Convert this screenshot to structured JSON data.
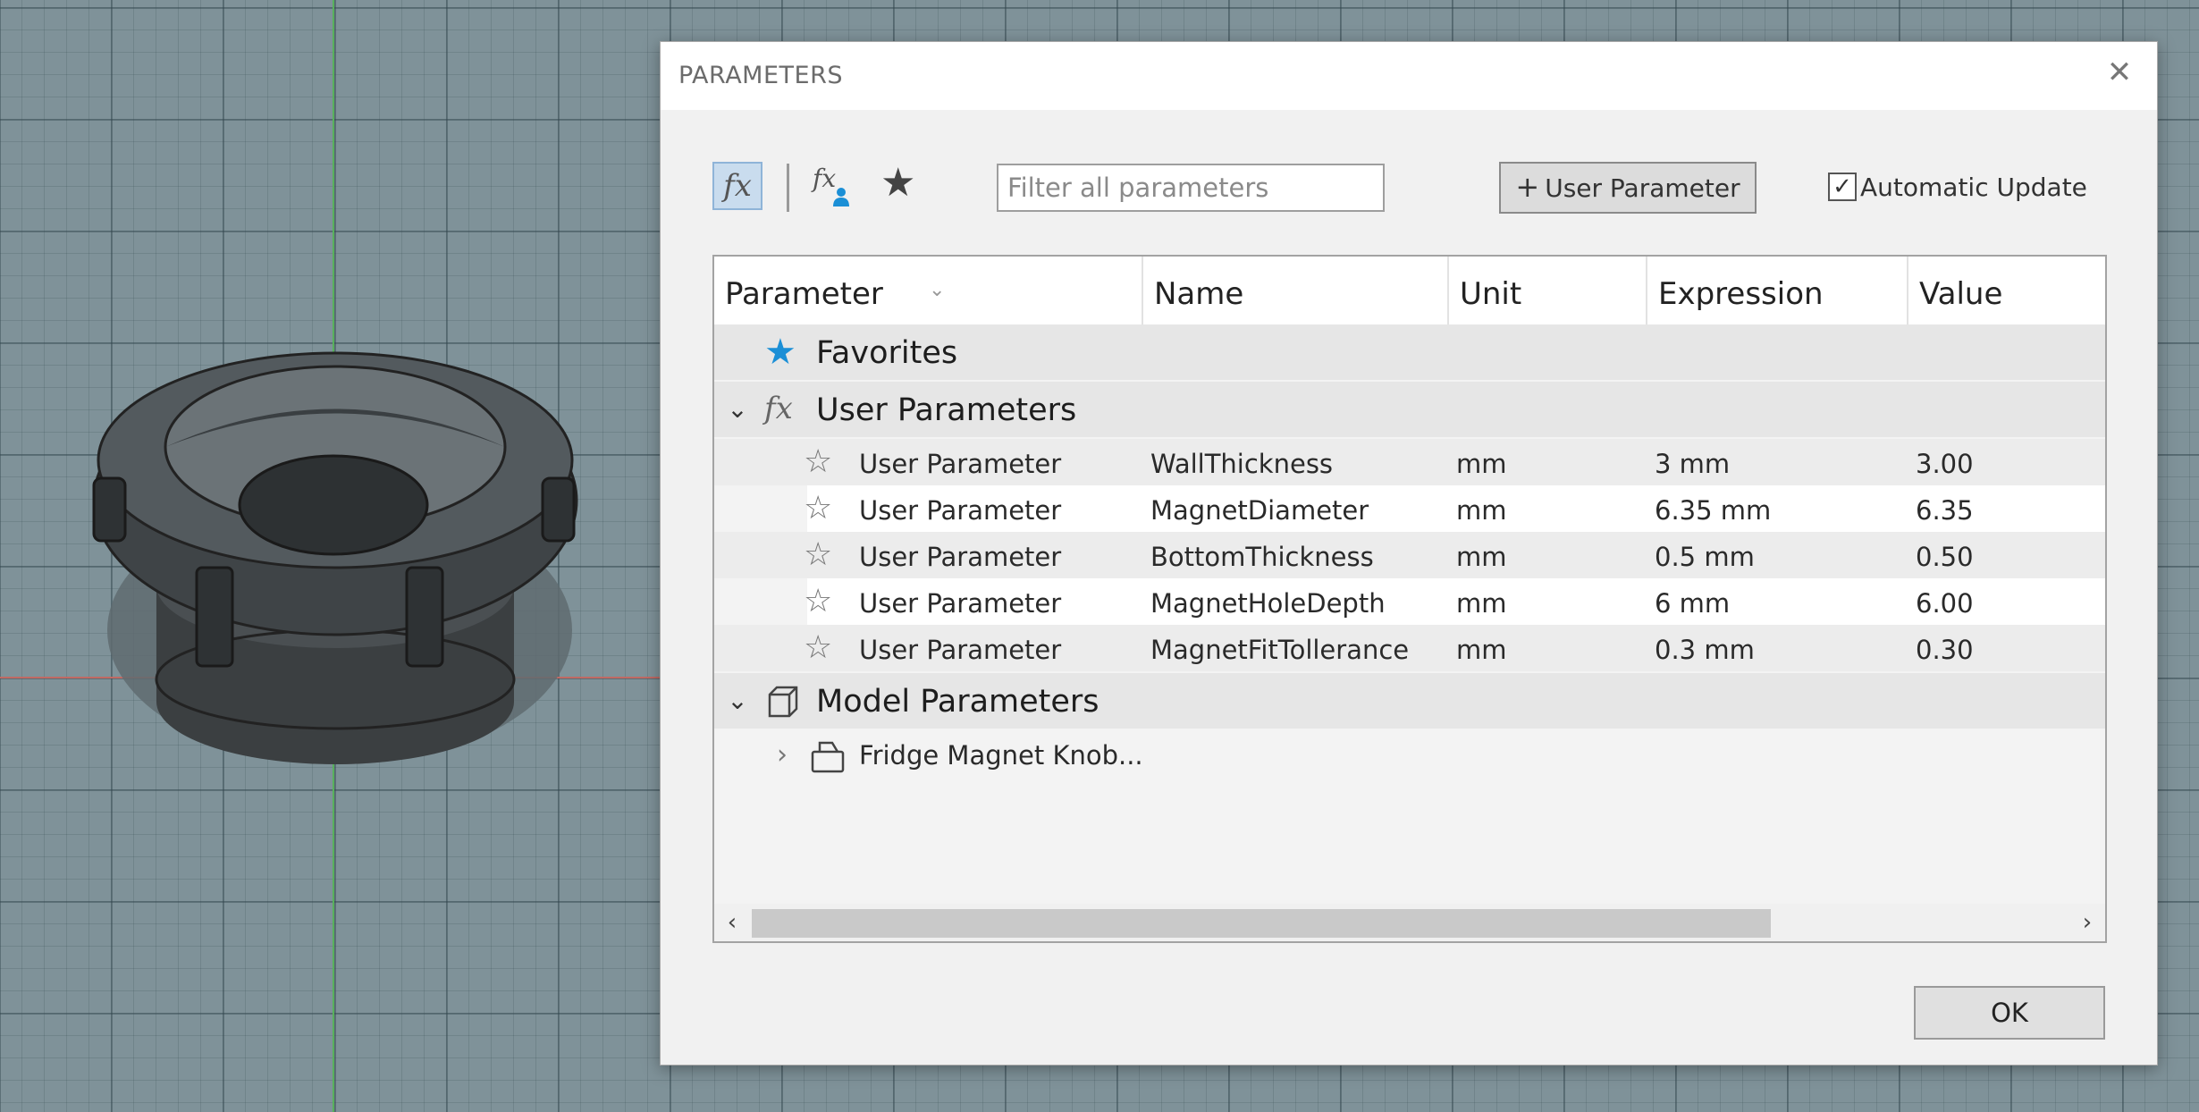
{
  "dialog": {
    "title": "PARAMETERS",
    "close_icon": "close-icon"
  },
  "toolbar": {
    "fx_icon": "fx",
    "fx_user_icon": "fx",
    "favorites_icon": "★",
    "filter_placeholder": "Filter all parameters",
    "filter_value": "",
    "add_user_param_label": "User Parameter",
    "automatic_update_label": "Automatic Update",
    "automatic_update_checked": true
  },
  "table": {
    "columns": [
      "Parameter",
      "Name",
      "Unit",
      "Expression",
      "Value"
    ],
    "groups": {
      "favorites": "Favorites",
      "user_parameters": "User Parameters",
      "model_parameters": "Model Parameters"
    },
    "user_rows": [
      {
        "parameter": "User Parameter",
        "name": "WallThickness",
        "unit": "mm",
        "expression": "3 mm",
        "value": "3.00"
      },
      {
        "parameter": "User Parameter",
        "name": "MagnetDiameter",
        "unit": "mm",
        "expression": "6.35 mm",
        "value": "6.35"
      },
      {
        "parameter": "User Parameter",
        "name": "BottomThickness",
        "unit": "mm",
        "expression": "0.5 mm",
        "value": "0.50"
      },
      {
        "parameter": "User Parameter",
        "name": "MagnetHoleDepth",
        "unit": "mm",
        "expression": "6 mm",
        "value": "6.00"
      },
      {
        "parameter": "User Parameter",
        "name": "MagnetFitTollerance",
        "unit": "mm",
        "expression": "0.3 mm",
        "value": "0.30"
      }
    ],
    "model_component": "Fridge Magnet Knob..."
  },
  "footer": {
    "ok_label": "OK"
  },
  "colors": {
    "accent_blue": "#1b8fd6",
    "viewport_bg": "#7f9299"
  }
}
